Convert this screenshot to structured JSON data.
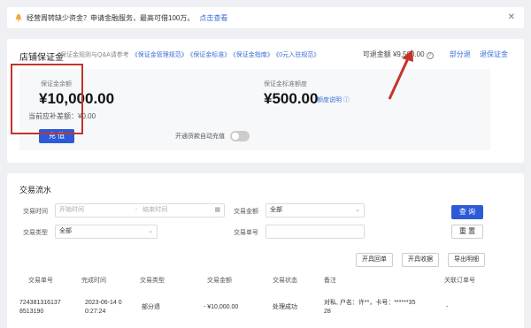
{
  "notice": {
    "text": "经营周转缺少资金？申请金融服务，最高可借100万。",
    "link": "点击查看"
  },
  "deposit": {
    "title": "店铺保证金",
    "note": "保证金规则与Q&A请参考",
    "links": [
      "《保证金管理规范》",
      "《保证金标准》",
      "《保证金指南》",
      "《0元入驻规范》"
    ],
    "available_label": "可退金额",
    "available_value": "¥9,500.00",
    "partial_refund": "部分退",
    "refund": "退保证金",
    "balance_label": "保证金余额",
    "balance_value": "¥10,000.00",
    "due_label": "当前应补差额：",
    "due_value": "¥0.00",
    "recharge_button": "充 值",
    "auto_recharge_label": "开通货款自动充值",
    "standard_label": "保证金标准额度",
    "standard_value": "¥500.00",
    "detail_link": "额度说明"
  },
  "colors": {
    "accent": "#2d5bd7",
    "annotation": "#c3342a"
  },
  "transactions": {
    "title": "交易流水",
    "filters": {
      "time_label": "交易时间",
      "start_placeholder": "开始时间",
      "separator": "-",
      "end_placeholder": "结束时间",
      "amount_label": "交易金额",
      "amount_value": "全部",
      "type_label": "交易类型",
      "type_value": "全部",
      "number_label": "交易单号"
    },
    "query_button": "查 询",
    "reset_button": "重 置",
    "open_invoice": "开具回单",
    "open_receipt": "开具收据",
    "export": "导出明细",
    "columns": [
      "交易单号",
      "完成时间",
      "交易类型",
      "交易金额",
      "交易状态",
      "备注",
      "关联订单号"
    ],
    "row": {
      "number_line1": "724381316137",
      "number_line2": "8513190",
      "time_line1": "2023-06-14 0",
      "time_line2": "0:27:24",
      "type": "部分退",
      "amount": "- ¥10,000.00",
      "status": "处理成功",
      "remark_line1": "对私, 户名：许**，卡号：******35",
      "remark_line2": "28",
      "order": "-"
    }
  }
}
